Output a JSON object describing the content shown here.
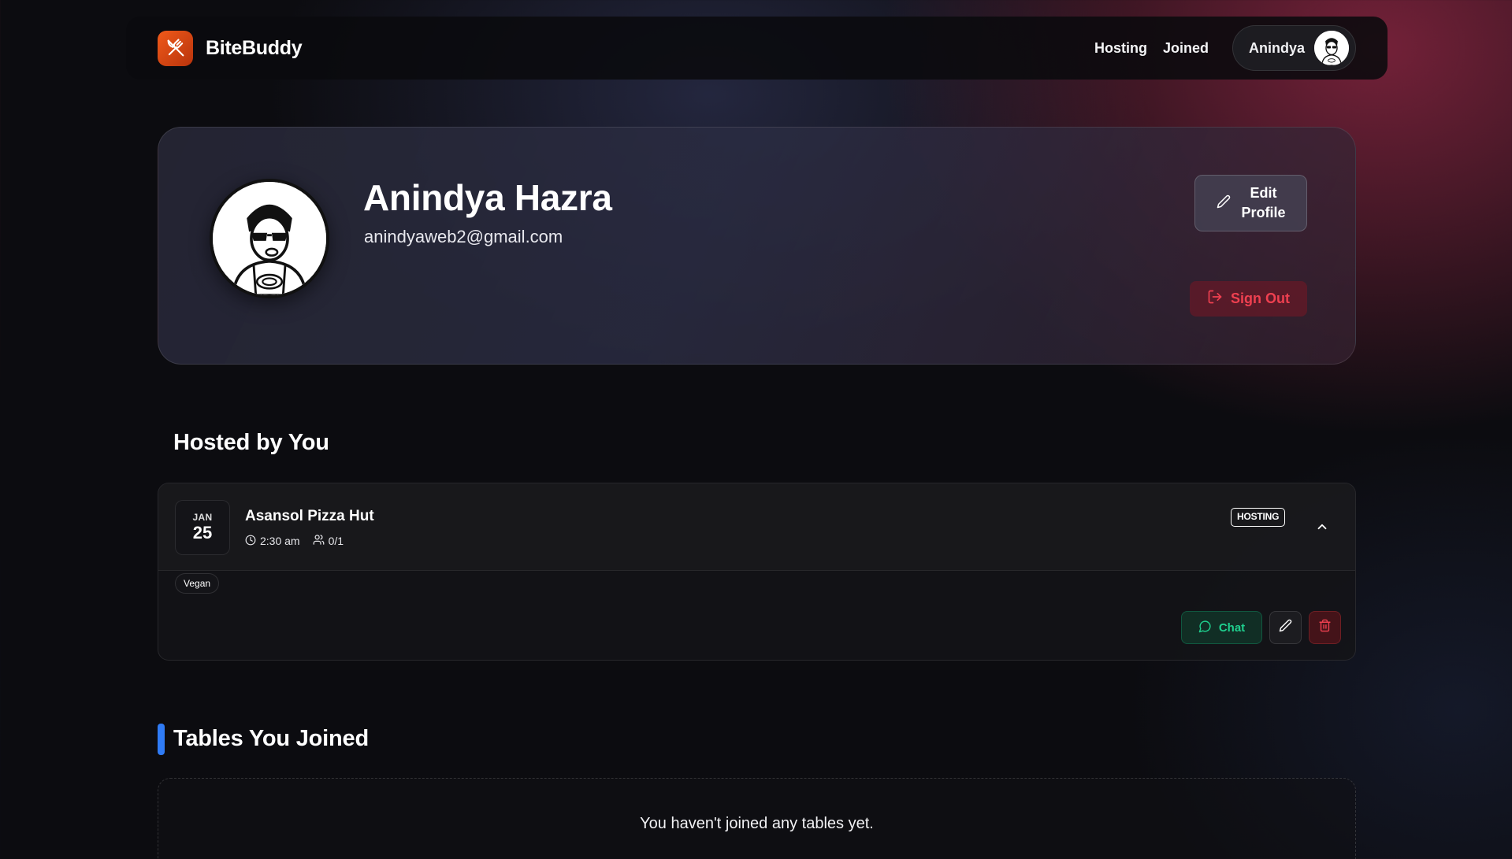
{
  "app": {
    "name": "BiteBuddy",
    "logo_icon": "fork-knife-icon",
    "accent": "#f05a1a"
  },
  "nav": {
    "links": [
      "Hosting",
      "Joined"
    ],
    "user_name": "Anindya"
  },
  "profile": {
    "name": "Anindya Hazra",
    "email": "anindyaweb2@gmail.com",
    "edit_label": "Edit Profile",
    "signout_label": "Sign Out"
  },
  "hosted": {
    "title": "Hosted by You",
    "events": [
      {
        "month": "JAN",
        "day": "25",
        "title": "Asansol Pizza Hut",
        "time": "2:30 am",
        "seats": "0/1",
        "badge": "HOSTING",
        "tags": [
          "Vegan"
        ],
        "chat_label": "Chat"
      }
    ]
  },
  "joined": {
    "title": "Tables You Joined",
    "empty_message": "You haven't joined any tables yet."
  },
  "colors": {
    "joined_accent_bar": "#2f7bf5",
    "chat_green": "#1fcf8e",
    "danger_red": "#ef4050"
  }
}
